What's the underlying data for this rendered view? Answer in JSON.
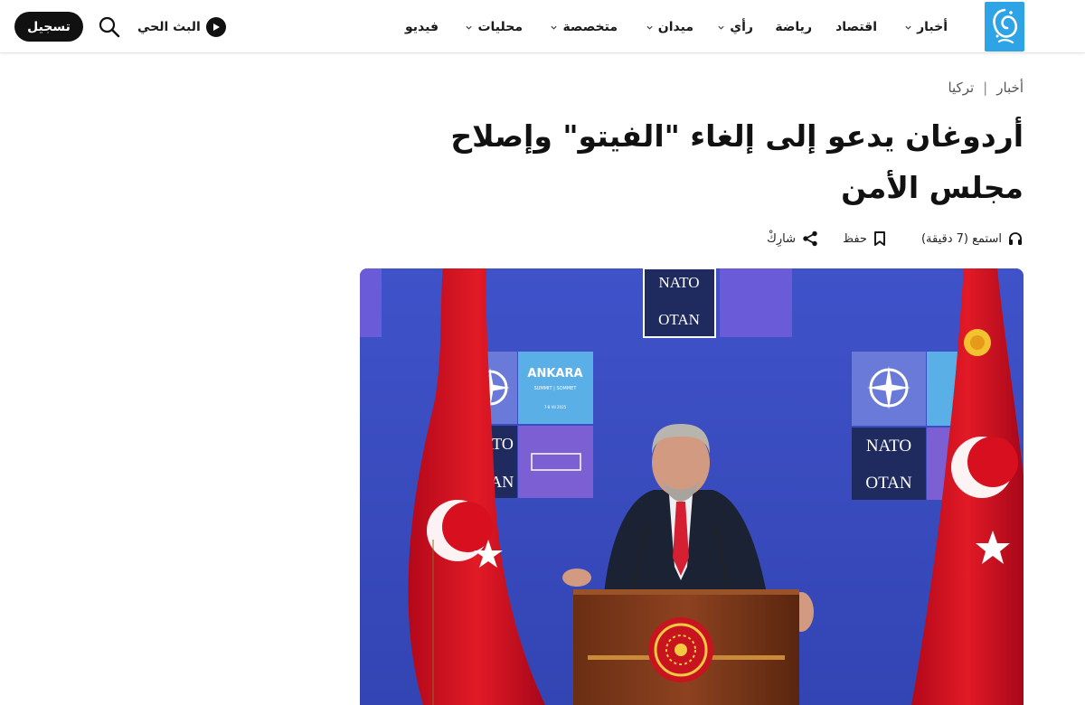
{
  "header": {
    "nav": [
      {
        "label": "أخبار",
        "dropdown": true
      },
      {
        "label": "اقتصاد",
        "dropdown": false
      },
      {
        "label": "رياضة",
        "dropdown": false
      },
      {
        "label": "رأي",
        "dropdown": true
      },
      {
        "label": "ميدان",
        "dropdown": true
      },
      {
        "label": "متخصصة",
        "dropdown": true
      },
      {
        "label": "محليات",
        "dropdown": true
      },
      {
        "label": "فيديو",
        "dropdown": false
      }
    ],
    "live_label": "البث الحي",
    "register_label": "تسجيل",
    "icons": {
      "logo": "aljazeera-logo",
      "search": "search-icon",
      "live": "play-icon"
    }
  },
  "breadcrumb": [
    "أخبار",
    "تركيا"
  ],
  "article": {
    "title_line1": "أردوغان يدعو إلى إلغاء \"الفيتو\" وإصلاح",
    "title_line2": "مجلس الأمن",
    "listen_label": "استمع (7 دقيقة)",
    "save_label": "حفظ",
    "share_label": "شارِكْ",
    "image_signs": {
      "nato": "NATO",
      "otan": "OTAN",
      "summit": "ANKARA",
      "summit_sub": "SUMMIT | SOMMET",
      "summit_date": "7-8 VII 2025"
    }
  },
  "colors": {
    "accent": "#fbb03b",
    "header_text": "#1a1a1a",
    "backdrop_blue": "#3d4fc6",
    "flag_red": "#e30a17"
  }
}
